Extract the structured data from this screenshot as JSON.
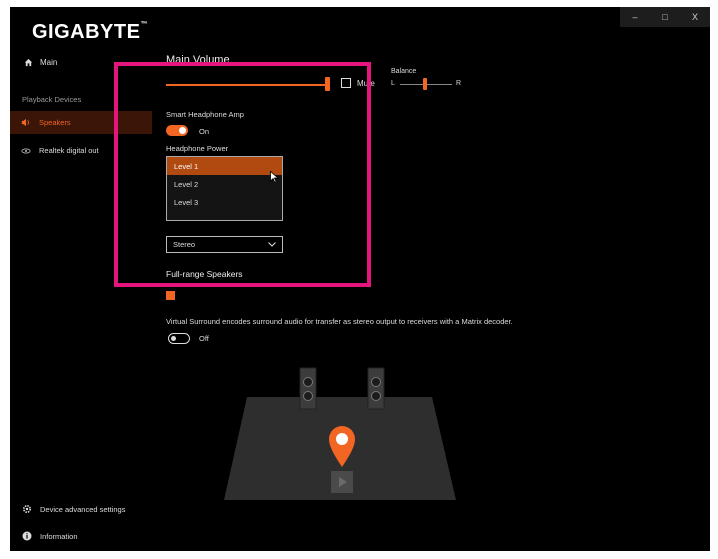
{
  "window": {
    "controls": [
      "–",
      "□",
      "X"
    ]
  },
  "app": {
    "logo": "GIGABYTE",
    "logo_tm": "™"
  },
  "sidebar": {
    "main_label": "Main",
    "section_label": "Playback Devices",
    "devices": [
      {
        "label": "Speakers",
        "active": true
      },
      {
        "label": "Realtek digital out",
        "active": false
      }
    ],
    "bottom": [
      {
        "label": "Device advanced settings"
      },
      {
        "label": "Information"
      }
    ]
  },
  "main": {
    "title": "Main Volume",
    "mute_label": "Mute",
    "balance": {
      "label": "Balance",
      "left": "L",
      "right": "R"
    },
    "smart_amp": {
      "label": "Smart Headphone Amp",
      "state": "On",
      "on": true
    },
    "headphone_power": {
      "label": "Headphone Power",
      "options": [
        "Level 1",
        "Level 2",
        "Level 3"
      ],
      "selected": "Level 1"
    },
    "config_select": {
      "value": "Stereo"
    },
    "fullrange_title": "Full-range Speakers",
    "virtual_surround": {
      "description": "Virtual Surround encodes surround audio for transfer as stereo output to receivers with a Matrix decoder.",
      "state": "Off",
      "on": false
    }
  },
  "colors": {
    "accent": "#f26522",
    "highlight": "#e6157e",
    "background": "#000000"
  }
}
